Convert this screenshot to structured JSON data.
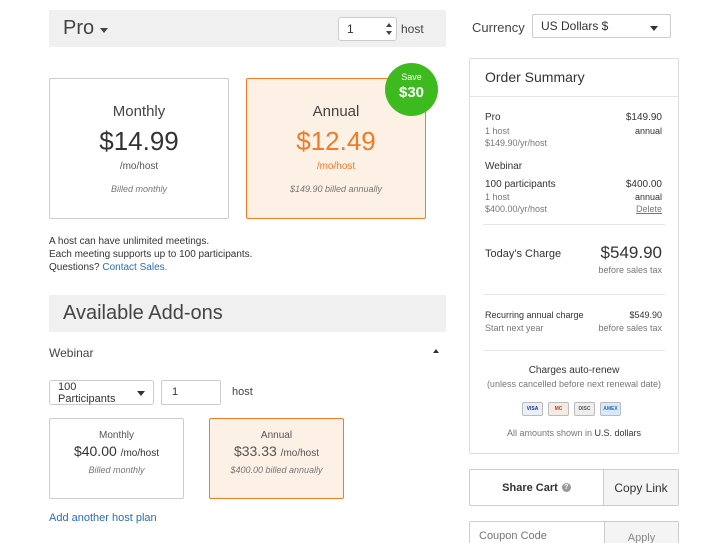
{
  "plan": {
    "name": "Pro",
    "host_count": "1",
    "host_label": "host"
  },
  "plan_cards": [
    {
      "label": "Monthly",
      "price": "$14.99",
      "unit": "/mo/host",
      "billed": "Billed monthly"
    },
    {
      "label": "Annual",
      "price": "$12.49",
      "unit": "/mo/host",
      "billed": "$149.90 billed annually"
    }
  ],
  "save_badge": {
    "line1": "Save",
    "line2": "$30"
  },
  "info": {
    "line1": "A host can have unlimited meetings.",
    "line2": "Each meeting supports up to 100 participants.",
    "line3_prefix": "Questions?",
    "line3_link": "Contact Sales."
  },
  "addons": {
    "title": "Available Add-ons",
    "webinar_label": "Webinar",
    "participants": "100 Participants",
    "qty": "1",
    "host_label": "host",
    "cards": [
      {
        "label": "Monthly",
        "price": "$40.00",
        "unit": "/mo/host",
        "billed": "Billed monthly"
      },
      {
        "label": "Annual",
        "price": "$33.33",
        "unit": "/mo/host",
        "billed": "$400.00 billed annually"
      }
    ],
    "add_host_link": "Add another host plan"
  },
  "currency": {
    "label": "Currency",
    "value": "US Dollars $"
  },
  "order": {
    "title": "Order Summary",
    "pro": {
      "name": "Pro",
      "price": "$149.90",
      "line2_left": "1 host",
      "line2_right": "annual",
      "line3": "$149.90/yr/host"
    },
    "webinar": {
      "name": "Webinar",
      "line1_left": "100 participants",
      "line1_right": "$400.00",
      "line2_left": "1 host",
      "line2_right": "annual",
      "line3_left": "$400.00/yr/host",
      "delete": "Delete"
    },
    "today": {
      "label": "Today's Charge",
      "amount": "$549.90",
      "note": "before sales tax"
    },
    "recurring": {
      "label": "Recurring annual charge",
      "amount": "$549.90",
      "sub_left": "Start next year",
      "sub_right": "before sales tax"
    },
    "auto_renew": "Charges auto-renew",
    "auto_renew_sub": "(unless cancelled before next renewal date)",
    "cards": [
      "VISA",
      "MC",
      "DISC",
      "AMEX"
    ],
    "all_amounts_prefix": "All amounts shown in",
    "all_amounts_currency": "U.S. dollars"
  },
  "share": {
    "share_cart": "Share Cart",
    "help": "?",
    "copy_link": "Copy Link"
  },
  "coupon": {
    "placeholder": "Coupon Code",
    "apply": "Apply"
  },
  "colors": {
    "accent": "#f07b29",
    "save_green": "#3dbb1e",
    "link": "#2a6ebb"
  }
}
